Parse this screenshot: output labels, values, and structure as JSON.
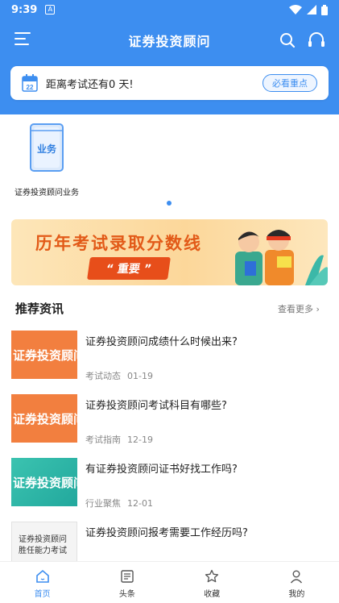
{
  "status_bar": {
    "time": "9:39",
    "notif_glyph": "A",
    "icons": [
      "wifi-icon",
      "signal-icon",
      "battery-icon"
    ]
  },
  "header": {
    "title": "证券投资顾问",
    "icons": [
      "menu-icon",
      "search-icon",
      "headset-icon"
    ]
  },
  "countdown": {
    "calendar_day": "22",
    "text": "距离考试还有0 天!",
    "button_label": "必看重点"
  },
  "category": {
    "label": "证券投资顾问业务",
    "book_label": "业务"
  },
  "banner": {
    "title": "历年考试录取分数线",
    "tag": "“ 重要 ”"
  },
  "news": {
    "section_title": "推荐资讯",
    "more_label": "查看更多",
    "items": [
      {
        "title": "证券投资顾问成绩什么时候出来?",
        "tag": "考试动态",
        "date": "01-19",
        "thumb_text": "证券投资顾问",
        "thumb_style": "orange"
      },
      {
        "title": "证券投资顾问考试科目有哪些?",
        "tag": "考试指南",
        "date": "12-19",
        "thumb_text": "证券投资顾问",
        "thumb_style": "orange"
      },
      {
        "title": "有证券投资顾问证书好找工作吗?",
        "tag": "行业聚焦",
        "date": "12-01",
        "thumb_text": "证券投资顾问",
        "thumb_style": "teal"
      },
      {
        "title": "证券投资顾问报考需要工作经历吗?",
        "tag": "",
        "date": "",
        "thumb_text": "证券投资顾问",
        "thumb_text_2": "胜任能力考试",
        "thumb_style": "paper"
      }
    ]
  },
  "bottom_nav": {
    "items": [
      {
        "label": "首页",
        "icon": "home-icon",
        "active": true
      },
      {
        "label": "头条",
        "icon": "news-icon",
        "active": false
      },
      {
        "label": "收藏",
        "icon": "star-icon",
        "active": false
      },
      {
        "label": "我的",
        "icon": "user-icon",
        "active": false
      }
    ]
  },
  "colors": {
    "primary": "#3d8ef0",
    "banner_accent": "#e25a18",
    "thumb_orange": "#f27f3f",
    "thumb_teal": "#2fb6a6"
  }
}
